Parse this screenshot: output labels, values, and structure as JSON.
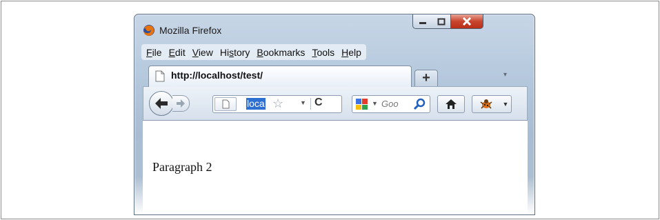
{
  "window": {
    "title": "Mozilla Firefox",
    "icon": "firefox-icon",
    "controls": [
      "minimize-icon",
      "maximize-icon",
      "close-icon"
    ]
  },
  "menu": {
    "items": [
      {
        "label": "File",
        "accel": "F",
        "rest": "ile"
      },
      {
        "label": "Edit",
        "accel": "E",
        "rest": "dit"
      },
      {
        "label": "View",
        "accel": "V",
        "rest": "iew"
      },
      {
        "label": "History",
        "pre": "Hi",
        "accel": "s",
        "rest": "tory"
      },
      {
        "label": "Bookmarks",
        "accel": "B",
        "rest": "ookmarks"
      },
      {
        "label": "Tools",
        "accel": "T",
        "rest": "ools"
      },
      {
        "label": "Help",
        "accel": "H",
        "rest": "elp"
      }
    ]
  },
  "tabs": {
    "active": {
      "title": "http://localhost/test/",
      "icon": "page-icon"
    },
    "new_tab_label": "+"
  },
  "toolbar": {
    "url_selected_text": "loca",
    "search_placeholder": "Goo",
    "icons": [
      "back-arrow-icon",
      "forward-arrow-icon",
      "page-icon",
      "star-icon",
      "reload-icon",
      "google-icon",
      "magnifier-icon",
      "home-icon",
      "addon-icon"
    ]
  },
  "content": {
    "paragraph": "Paragraph 2"
  },
  "colors": {
    "selection": "#2e6fd2",
    "close_button": "#c8452d",
    "chrome": "#b3c7dc"
  }
}
